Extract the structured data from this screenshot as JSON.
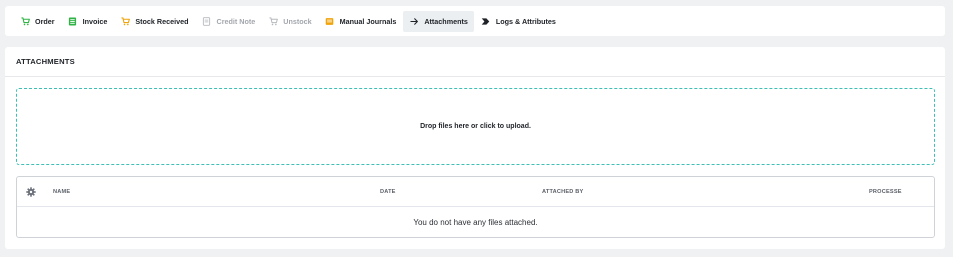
{
  "tabs": [
    {
      "label": "Order",
      "icon": "cart-icon",
      "color": "#2fb344",
      "state": "normal"
    },
    {
      "label": "Invoice",
      "icon": "invoice-icon",
      "color": "#2fb344",
      "state": "normal"
    },
    {
      "label": "Stock Received",
      "icon": "cart-icon",
      "color": "#f0a30a",
      "state": "normal"
    },
    {
      "label": "Credit Note",
      "icon": "document-icon",
      "color": "#b5b9be",
      "state": "disabled"
    },
    {
      "label": "Unstock",
      "icon": "cart-icon",
      "color": "#b5b9be",
      "state": "disabled"
    },
    {
      "label": "Manual Journals",
      "icon": "journal-icon",
      "color": "#f0a30a",
      "state": "normal"
    },
    {
      "label": "Attachments",
      "icon": "arrow-right-icon",
      "color": "#1f2328",
      "state": "active"
    },
    {
      "label": "Logs & Attributes",
      "icon": "chevron-tag-icon",
      "color": "#1f2328",
      "state": "normal"
    }
  ],
  "attachments": {
    "title": "ATTACHMENTS",
    "dropzone_text": "Drop files here or click to upload.",
    "columns": [
      "NAME",
      "DATE",
      "ATTACHED BY",
      "PROCESSE"
    ],
    "empty_message": "You do not have any files attached."
  },
  "colors": {
    "dropzone_border": "#3cbfb4",
    "active_tab_bg": "#eceff2"
  }
}
